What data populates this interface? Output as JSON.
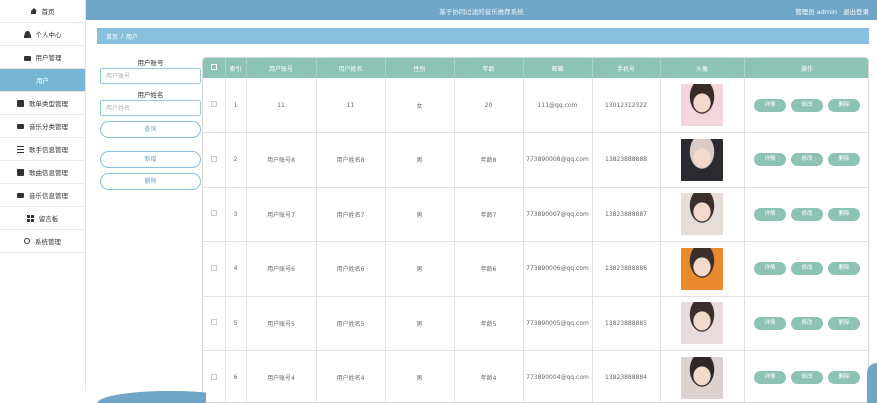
{
  "header": {
    "title": "基于协同过滤的音乐推荐系统",
    "role_label": "管理员 admin",
    "logout_label": "退出登录"
  },
  "sidebar": {
    "items": [
      {
        "label": "首页",
        "icon": "home-icon"
      },
      {
        "label": "个人中心",
        "icon": "user-icon"
      },
      {
        "label": "用户管理",
        "icon": "bag-icon"
      },
      {
        "label": "用户",
        "icon": "",
        "active": true
      },
      {
        "label": "歌单类型管理",
        "icon": "album-icon"
      },
      {
        "label": "音乐分类管理",
        "icon": "monitor-icon"
      },
      {
        "label": "歌手信息管理",
        "icon": "list-icon"
      },
      {
        "label": "歌曲信息管理",
        "icon": "album-icon"
      },
      {
        "label": "音乐信息管理",
        "icon": "monitor-icon"
      },
      {
        "label": "留言板",
        "icon": "grid-icon"
      },
      {
        "label": "系统管理",
        "icon": "gear-icon"
      }
    ]
  },
  "breadcrumb": {
    "home": "首页",
    "sep": "/",
    "current": "用户"
  },
  "search": {
    "account_label": "用户账号",
    "account_placeholder": "用户账号",
    "name_label": "用户姓名",
    "name_placeholder": "用户姓名",
    "query_button": "查询",
    "add_button": "新增",
    "delete_button": "删除"
  },
  "table": {
    "columns": [
      "",
      "索引",
      "用户账号",
      "用户姓名",
      "性别",
      "年龄",
      "邮箱",
      "手机号",
      "头像",
      "操作"
    ],
    "actions": {
      "detail": "详情",
      "edit": "修改",
      "delete": "删除"
    },
    "rows": [
      {
        "index": "1",
        "account": "11",
        "name": "11",
        "gender": "女",
        "age": "20",
        "email": "111@qq.com",
        "phone": "13012312322",
        "avatar_colors": [
          "#f2d6dc",
          "#3a2a2a"
        ]
      },
      {
        "index": "2",
        "account": "用户账号8",
        "name": "用户姓名8",
        "gender": "男",
        "age": "年龄8",
        "email": "773890008@qq.com",
        "phone": "13823888888",
        "avatar_colors": [
          "#2b2a30",
          "#d9cbc8"
        ]
      },
      {
        "index": "3",
        "account": "用户账号7",
        "name": "用户姓名7",
        "gender": "男",
        "age": "年龄7",
        "email": "773890007@qq.com",
        "phone": "13823888887",
        "avatar_colors": [
          "#e7ddd8",
          "#3b2d2a"
        ]
      },
      {
        "index": "4",
        "account": "用户账号6",
        "name": "用户姓名6",
        "gender": "男",
        "age": "年龄6",
        "email": "773890006@qq.com",
        "phone": "13823888886",
        "avatar_colors": [
          "#e98a2e",
          "#3a2f2a"
        ]
      },
      {
        "index": "5",
        "account": "用户账号5",
        "name": "用户姓名5",
        "gender": "男",
        "age": "年龄5",
        "email": "773890005@qq.com",
        "phone": "13823888885",
        "avatar_colors": [
          "#e9dcdc",
          "#3d2e2e"
        ]
      },
      {
        "index": "6",
        "account": "用户账号4",
        "name": "用户姓名4",
        "gender": "男",
        "age": "年龄4",
        "email": "773890004@qq.com",
        "phone": "13823888884",
        "avatar_colors": [
          "#dcd2cf",
          "#2f2828"
        ]
      }
    ]
  },
  "colors": {
    "header": "#6fa6c8",
    "breadcrumb": "#88c0dd",
    "table_head": "#8dc3b4",
    "action_button": "#8dc3b4"
  }
}
